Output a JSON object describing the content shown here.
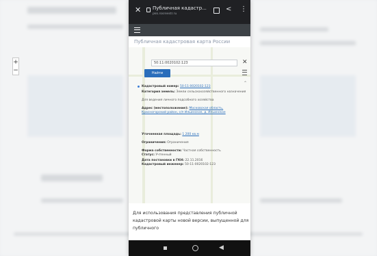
{
  "browser": {
    "title": "Публичная кадастр...",
    "url": "pkk.rosreestr.ru",
    "icons": [
      "close-icon",
      "lock-icon",
      "tabs-icon",
      "share-icon",
      "more-vert-icon"
    ]
  },
  "site": {
    "heading": "Публичная кадастровая карта России",
    "menu_icon": "menu-icon"
  },
  "map": {
    "search_value": "50:11:0020102:123",
    "find_label": "Найти",
    "zoom_in": "+",
    "zoom_out": "−",
    "close_glyph": "✕",
    "collapse_glyph": "⌃"
  },
  "object_info": {
    "kadastr_label": "Кадастровый номер:",
    "kadastr_value": "50:11:0020102:123",
    "category_label": "Категория земель:",
    "category_value": "Земли сельскохозяйственного назначения",
    "use_value": "Для ведения личного подсобного хозяйства",
    "address_label": "Адрес (местоположение):",
    "address_value": "Московская область, Красногорский район, с/п Ильинское, д. Ильинское",
    "area_label": "Уточненная площадь:",
    "area_value": "1 200 кв.м",
    "status_label": "Ограничения:",
    "status_value": "Ограничения",
    "ownership_label": "Форма собственности:",
    "ownership_value": "Частная собственность",
    "state_label": "Статус:",
    "state_value": "Учтенный",
    "date_label": "Дата постановки в ГКН:",
    "date_value": "22.11.2016",
    "engineer_label": "Кадастровый инженер:",
    "engineer_value": "50-11-0020102-123"
  },
  "body": {
    "text": "Для использования представления публичной кадастровой карты новой версии, выпущенной для публичного"
  },
  "android_nav": {
    "icons": [
      "recents-icon",
      "home-icon",
      "back-icon"
    ]
  }
}
